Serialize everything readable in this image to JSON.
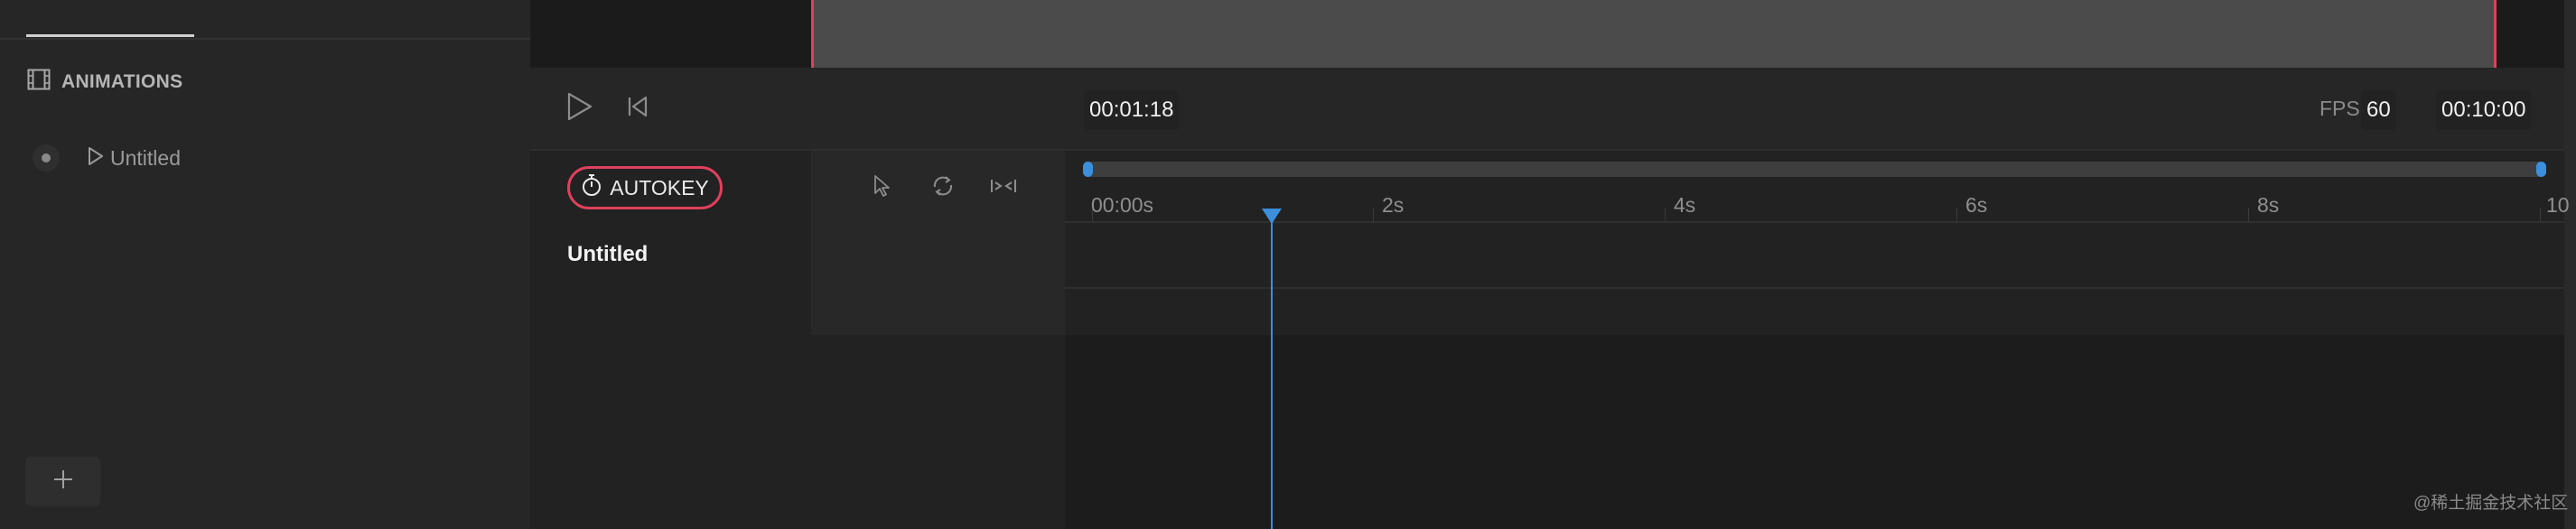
{
  "sidebar": {
    "section_title": "ANIMATIONS",
    "animations": [
      {
        "label": "Untitled"
      }
    ],
    "add_button": "+"
  },
  "transport": {
    "current_time": "00:01:18",
    "fps_label": "FPS",
    "fps_value": "60",
    "duration": "00:10:00"
  },
  "toolbar": {
    "autokey_label": "AUTOKEY"
  },
  "tracks": [
    {
      "name": "Untitled"
    }
  ],
  "timeline": {
    "ticks": [
      "00:00s",
      "2s",
      "4s",
      "6s",
      "8s",
      "10"
    ],
    "playhead_time_s": 1.3
  },
  "watermark": "@稀土掘金技术社区",
  "colors": {
    "accent": "#e0405c",
    "playhead": "#3b8fdc"
  }
}
